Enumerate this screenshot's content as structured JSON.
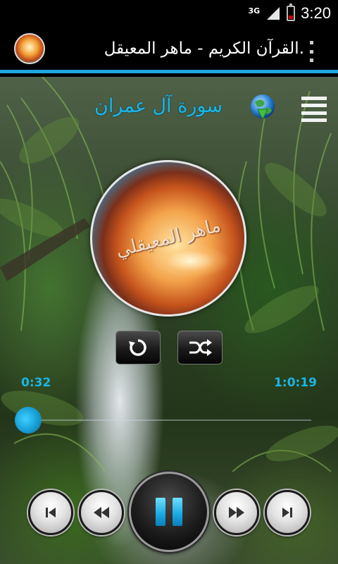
{
  "status_bar": {
    "network": "3G",
    "time": "3:20",
    "battery_level": 0.3,
    "battery_color": "#cc0000"
  },
  "action_bar": {
    "title": "القرآن الكريم - ماهر المعيقل.",
    "app_icon": "wave-logo-icon",
    "overflow_icon": "overflow-menu-icon",
    "accent_color": "#1ea6e0"
  },
  "player": {
    "surah_title": "سورة آل عمران",
    "globe_icon": "globe-download-icon",
    "list_icon": "playlist-menu-icon",
    "artwork_text": "ماهر المعيقلي",
    "elapsed": "0:32",
    "duration": "1:0:19",
    "progress": 0.009,
    "accent_color": "#1bb6e6"
  },
  "controls": {
    "repeat_icon": "repeat-icon",
    "shuffle_icon": "shuffle-icon",
    "prev_track_icon": "skip-previous-icon",
    "rewind_icon": "rewind-icon",
    "pause_icon": "pause-icon",
    "forward_icon": "fast-forward-icon",
    "next_track_icon": "skip-next-icon"
  }
}
